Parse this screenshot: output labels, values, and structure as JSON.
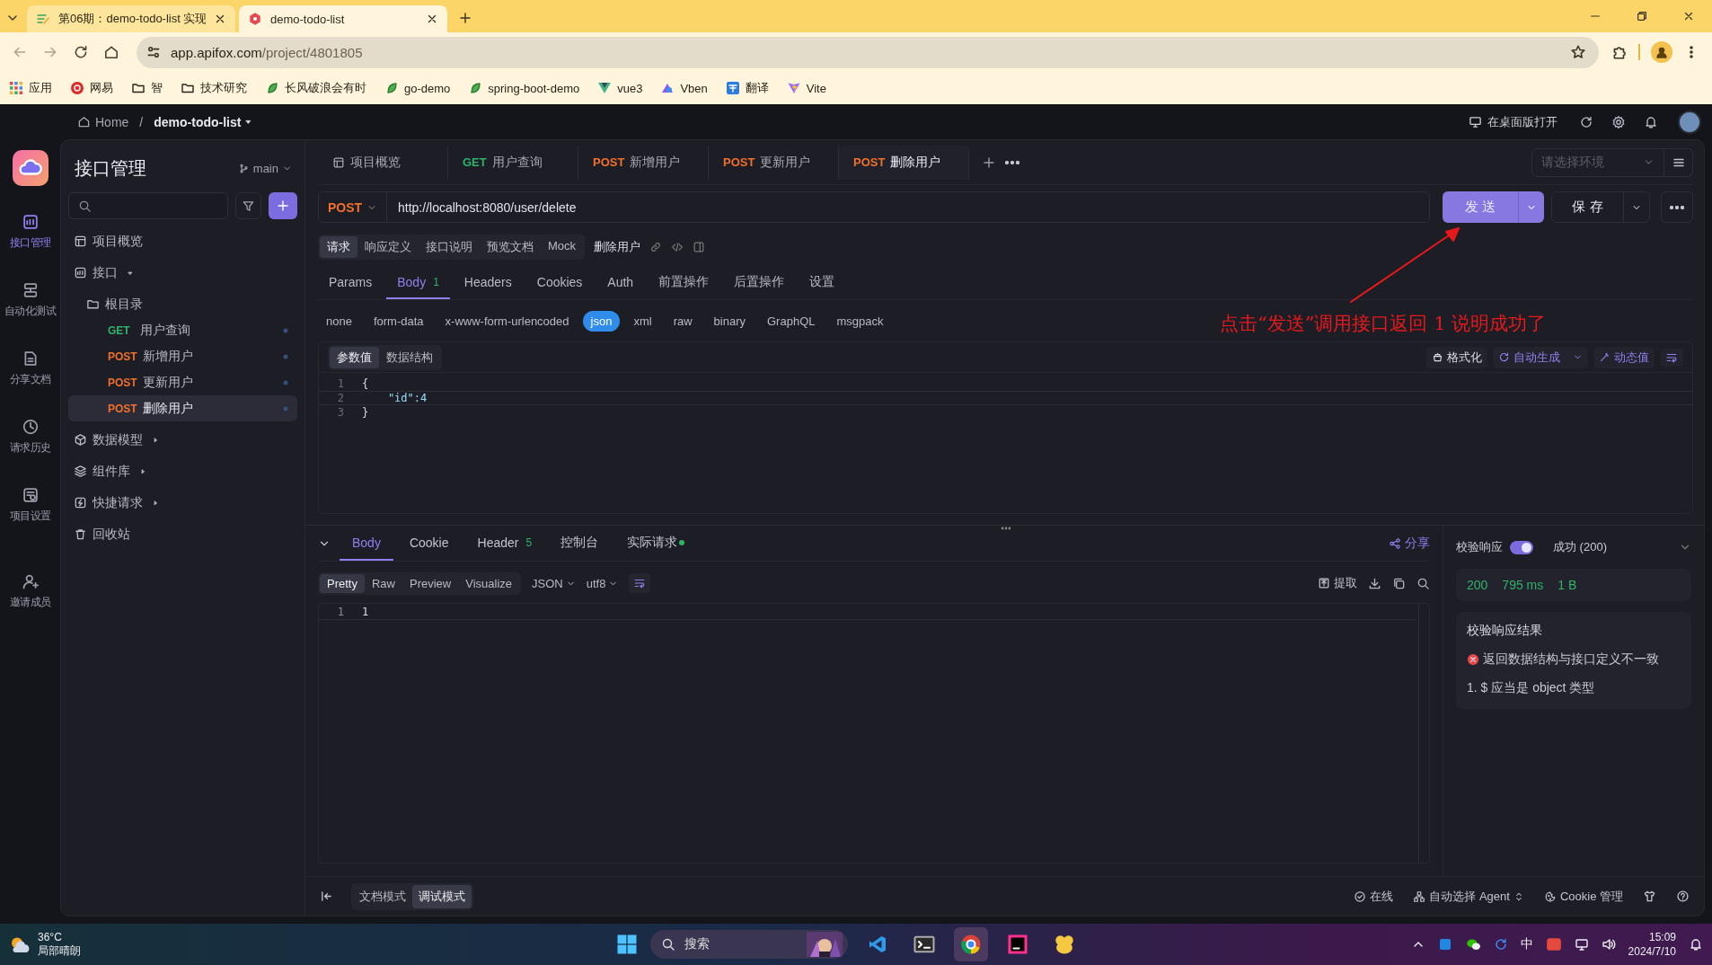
{
  "browser": {
    "tabs": [
      {
        "title": "第06期：demo-todo-list 实现",
        "selected": false
      },
      {
        "title": "demo-todo-list",
        "selected": true
      }
    ],
    "url_host": "app.apifox.com",
    "url_path": "/project/4801805",
    "bookmarks": [
      {
        "label": "应用",
        "kind": "apps"
      },
      {
        "label": "网易",
        "kind": "netease"
      },
      {
        "label": "智",
        "kind": "folder"
      },
      {
        "label": "技术研究",
        "kind": "folder"
      },
      {
        "label": "长风破浪会有时",
        "kind": "leaf"
      },
      {
        "label": "go-demo",
        "kind": "leaf"
      },
      {
        "label": "spring-boot-demo",
        "kind": "leaf"
      },
      {
        "label": "vue3",
        "kind": "vue"
      },
      {
        "label": "Vben",
        "kind": "vben"
      },
      {
        "label": "翻译",
        "kind": "translate"
      },
      {
        "label": "Vite",
        "kind": "vite"
      }
    ]
  },
  "topbar": {
    "home": "Home",
    "separator": "/",
    "project": "demo-todo-list",
    "open_desktop": "在桌面版打开"
  },
  "rail": [
    {
      "label": "接口管理",
      "selected": true
    },
    {
      "label": "自动化测试",
      "selected": false
    },
    {
      "label": "分享文档",
      "selected": false
    },
    {
      "label": "请求历史",
      "selected": false
    },
    {
      "label": "项目设置",
      "selected": false
    },
    {
      "label": "邀请成员",
      "selected": false
    }
  ],
  "sidebar": {
    "title": "接口管理",
    "branch": "main",
    "items": [
      {
        "label": "项目概览"
      },
      {
        "label": "接口",
        "expanded": true,
        "children": [
          {
            "label": "根目录",
            "kind": "folder",
            "children": [
              {
                "method": "GET",
                "label": "用户查询",
                "selected": false
              },
              {
                "method": "POST",
                "label": "新增用户",
                "selected": false
              },
              {
                "method": "POST",
                "label": "更新用户",
                "selected": false
              },
              {
                "method": "POST",
                "label": "删除用户",
                "selected": true
              }
            ]
          }
        ]
      },
      {
        "label": "数据模型",
        "expanded": false
      },
      {
        "label": "组件库",
        "expanded": false
      },
      {
        "label": "快捷请求",
        "expanded": false
      },
      {
        "label": "回收站"
      }
    ]
  },
  "tabs": [
    {
      "label": "项目概览",
      "selected": false
    },
    {
      "method": "GET",
      "label": "用户查询",
      "selected": false
    },
    {
      "method": "POST",
      "label": "新增用户",
      "selected": false
    },
    {
      "method": "POST",
      "label": "更新用户",
      "selected": false
    },
    {
      "method": "POST",
      "label": "删除用户",
      "selected": true
    }
  ],
  "environment": {
    "placeholder": "请选择环境"
  },
  "request": {
    "method": "POST",
    "url": "http://localhost:8080/user/delete",
    "send": "发 送",
    "save": "保 存"
  },
  "doc_tabs": [
    {
      "label": "请求",
      "selected": true
    },
    {
      "label": "响应定义",
      "selected": false
    },
    {
      "label": "接口说明",
      "selected": false
    },
    {
      "label": "预览文档",
      "selected": false
    },
    {
      "label": "Mock",
      "selected": false
    }
  ],
  "api_name": "删除用户",
  "param_tabs": [
    {
      "label": "Params",
      "selected": false
    },
    {
      "label": "Body",
      "count": "1",
      "selected": true
    },
    {
      "label": "Headers",
      "selected": false
    },
    {
      "label": "Cookies",
      "selected": false
    },
    {
      "label": "Auth",
      "selected": false
    },
    {
      "label": "前置操作",
      "selected": false
    },
    {
      "label": "后置操作",
      "selected": false
    },
    {
      "label": "设置",
      "selected": false
    }
  ],
  "body_types": [
    {
      "label": "none",
      "selected": false
    },
    {
      "label": "form-data",
      "selected": false
    },
    {
      "label": "x-www-form-urlencoded",
      "selected": false
    },
    {
      "label": "json",
      "selected": true
    },
    {
      "label": "xml",
      "selected": false
    },
    {
      "label": "raw",
      "selected": false
    },
    {
      "label": "binary",
      "selected": false
    },
    {
      "label": "GraphQL",
      "selected": false
    },
    {
      "label": "msgpack",
      "selected": false
    }
  ],
  "body_modes": [
    {
      "label": "参数值",
      "selected": true
    },
    {
      "label": "数据结构",
      "selected": false
    }
  ],
  "editor_tools": {
    "format": "格式化",
    "generate": "自动生成",
    "dynamic": "动态值"
  },
  "request_body": [
    {
      "line": "1",
      "code": "{"
    },
    {
      "line": "2",
      "code": "    \"id\":4"
    },
    {
      "line": "3",
      "code": "}"
    }
  ],
  "response": {
    "tabs": [
      {
        "label": "Body",
        "selected": true
      },
      {
        "label": "Cookie",
        "selected": false
      },
      {
        "label": "Header",
        "count": "5",
        "selected": false
      },
      {
        "label": "控制台",
        "selected": false
      },
      {
        "label": "实际请求",
        "dot": true,
        "selected": false
      }
    ],
    "share": "分享",
    "views": [
      {
        "label": "Pretty",
        "selected": true
      },
      {
        "label": "Raw",
        "selected": false
      },
      {
        "label": "Preview",
        "selected": false
      },
      {
        "label": "Visualize",
        "selected": false
      }
    ],
    "format": "JSON",
    "encoding": "utf8",
    "extract": "提取",
    "lines": [
      {
        "line": "1",
        "code": "1"
      }
    ]
  },
  "validation": {
    "label": "校验响应",
    "on": true,
    "result": "成功 (200)",
    "status": "200",
    "time": "795 ms",
    "size": "1 B",
    "title": "校验响应结果",
    "error": "返回数据结构与接口定义不一致",
    "detail": "1. $ 应当是 object 类型"
  },
  "footer": {
    "modes": [
      {
        "label": "文档模式",
        "selected": false
      },
      {
        "label": "调试模式",
        "selected": true
      }
    ],
    "online": "在线",
    "agent": "自动选择 Agent",
    "cookie": "Cookie 管理"
  },
  "annotation": {
    "text": "点击“发送”调用接口返回 1 说明成功了"
  },
  "taskbar": {
    "temperature": "36°C",
    "weather": "局部晴朗",
    "search_placeholder": "搜索",
    "ime": "中",
    "time": "15:09",
    "date": "2024/7/10"
  }
}
